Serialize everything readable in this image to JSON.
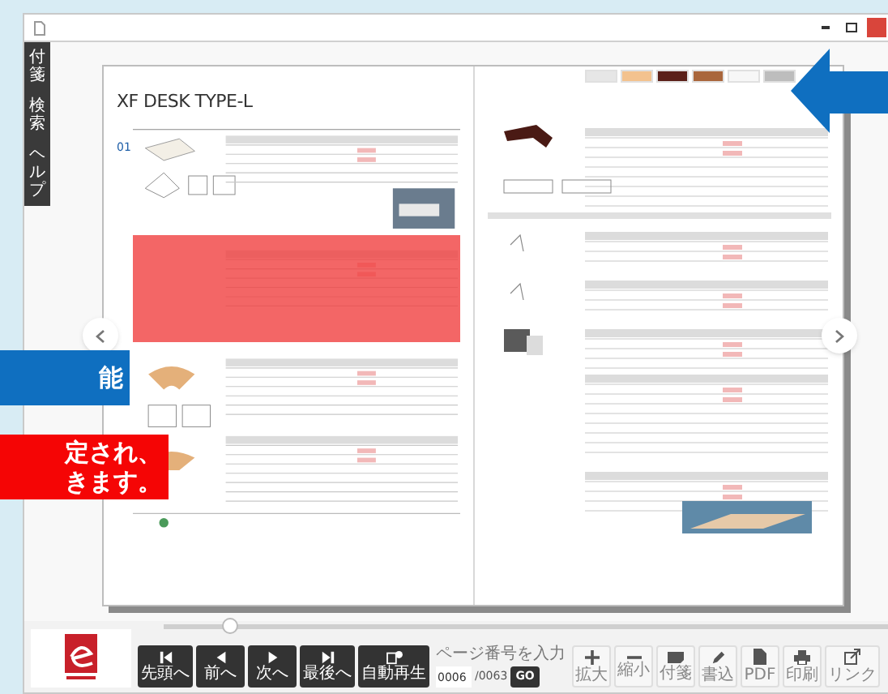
{
  "side_tabs": [
    {
      "label": "付箋"
    },
    {
      "label": "検索"
    },
    {
      "label": "ヘルプ"
    }
  ],
  "left_page": {
    "title": "XF DESK TYPE-L",
    "section_number": "01",
    "highlighted": true
  },
  "right_page": {
    "swatches": [
      {
        "color": "#e6e6e6"
      },
      {
        "color": "#f3c28e"
      },
      {
        "color": "#5b2019"
      },
      {
        "color": "#a9663c"
      },
      {
        "color": "#f7f7f7"
      },
      {
        "color": "#bdbdbd"
      }
    ]
  },
  "callouts": [
    {
      "kind": "blue",
      "lines": [
        "能"
      ]
    },
    {
      "kind": "red",
      "lines": [
        "定され、",
        "きます。"
      ]
    }
  ],
  "slider": {
    "level": 0.09
  },
  "nav_buttons": [
    {
      "label": "先頭へ"
    },
    {
      "label": "前へ"
    },
    {
      "label": "次へ"
    },
    {
      "label": "最後へ"
    },
    {
      "label": "自動再生"
    }
  ],
  "page_input": {
    "prompt": "ページ番号を入力",
    "value": "0006",
    "total": "/0063",
    "go": "GO"
  },
  "tools": [
    {
      "label": "拡大"
    },
    {
      "label": "縮小"
    },
    {
      "label": "付箋"
    },
    {
      "label": "書込"
    },
    {
      "label": "PDF"
    },
    {
      "label": "印刷"
    },
    {
      "label": "リンク"
    }
  ]
}
